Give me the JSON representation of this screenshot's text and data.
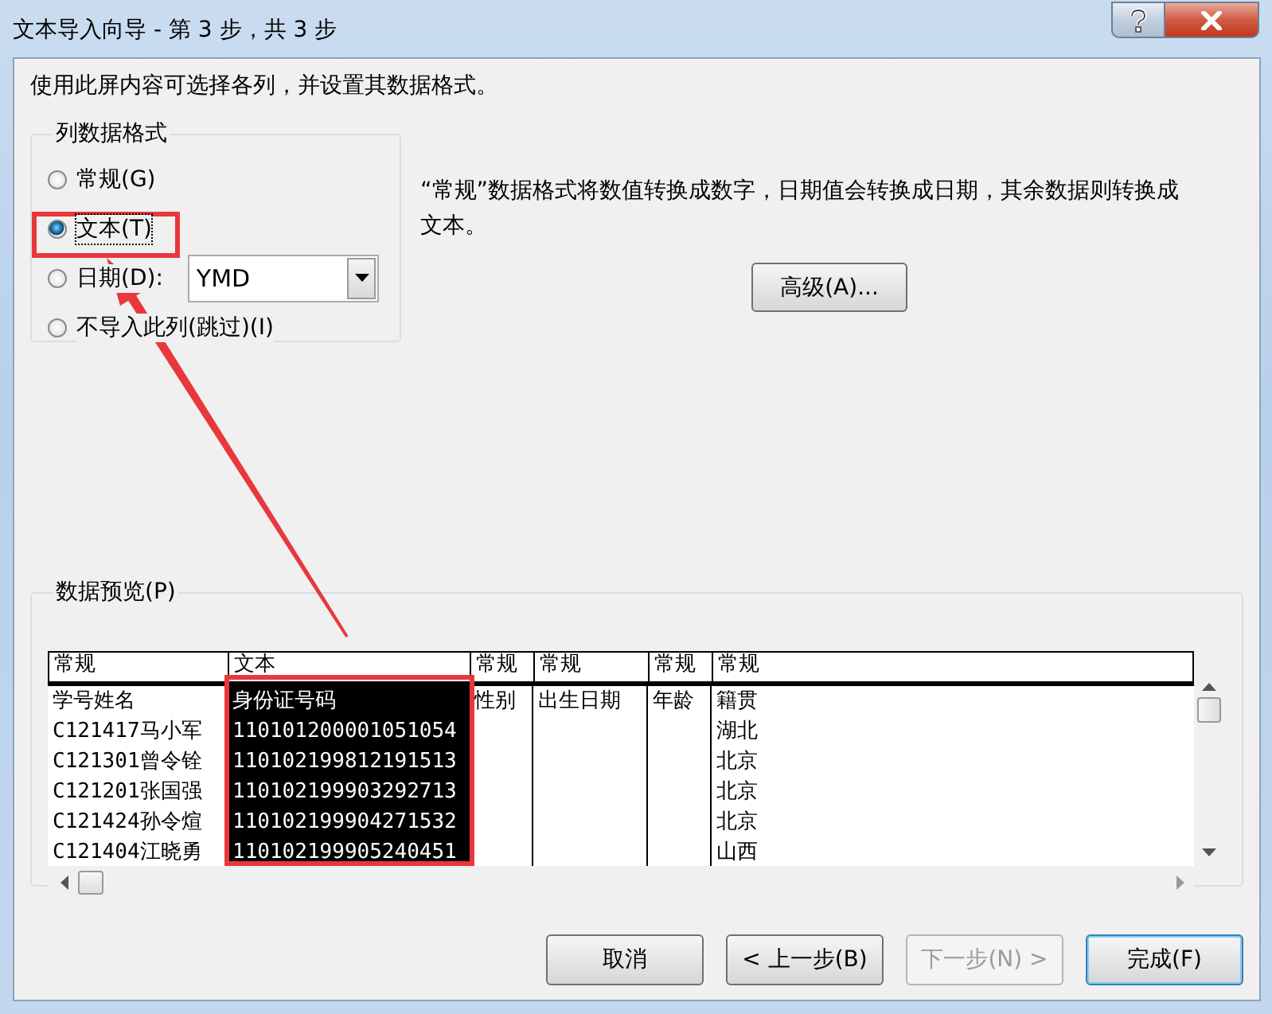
{
  "window": {
    "title": "文本导入向导 - 第 3 步，共 3 步"
  },
  "instruction": "使用此屏内容可选择各列，并设置其数据格式。",
  "column_format": {
    "legend": "列数据格式",
    "options": [
      {
        "label": "常规(G)",
        "selected": false
      },
      {
        "label": "文本(T)",
        "selected": true
      },
      {
        "label": "日期(D):",
        "selected": false,
        "kind": "date"
      },
      {
        "label": "不导入此列(跳过)(I)",
        "selected": false
      }
    ],
    "date_order": "YMD"
  },
  "description": "“常规”数据格式将数值转换成数字，日期值会转换成日期，其余数据则转换成文本。",
  "advanced_button": "高级(A)...",
  "preview": {
    "legend": "数据预览(P)",
    "columns": [
      {
        "format": "常规",
        "selected": false
      },
      {
        "format": "文本",
        "selected": true
      },
      {
        "format": "常规",
        "selected": false
      },
      {
        "format": "常规",
        "selected": false
      },
      {
        "format": "常规",
        "selected": false
      },
      {
        "format": "常规",
        "selected": false
      }
    ],
    "rows": [
      [
        "学号姓名",
        "身份证号码",
        "性别",
        "出生日期",
        "年龄",
        "籍贯"
      ],
      [
        "C121417马小军",
        "110101200001051054",
        null,
        null,
        null,
        "湖北"
      ],
      [
        "C121301曾令铨",
        "110102199812191513",
        null,
        null,
        null,
        "北京"
      ],
      [
        "C121201张国强",
        "110102199903292713",
        null,
        null,
        null,
        "北京"
      ],
      [
        "C121424孙令煊",
        "110102199904271532",
        null,
        null,
        null,
        "北京"
      ],
      [
        "C121404江晓勇",
        "110102199905240451",
        null,
        null,
        null,
        "山西"
      ]
    ]
  },
  "buttons": [
    {
      "label": "取消",
      "disabled": false,
      "default": false
    },
    {
      "label": "< 上一步(B)",
      "disabled": false,
      "default": false
    },
    {
      "label": "下一步(N) >",
      "disabled": true,
      "default": false
    },
    {
      "label": "完成(F)",
      "disabled": false,
      "default": true
    }
  ]
}
